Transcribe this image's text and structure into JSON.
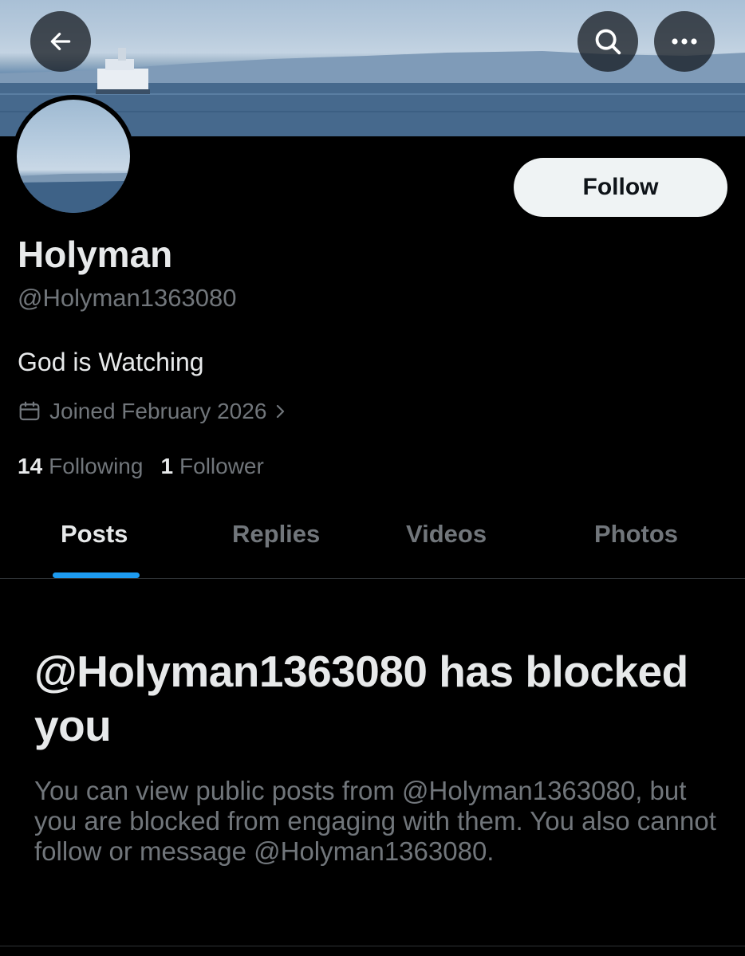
{
  "header": {
    "back_icon": "arrow-left-icon",
    "search_icon": "search-icon",
    "more_icon": "more-horizontal-icon"
  },
  "profile": {
    "follow_label": "Follow",
    "display_name": "Holyman",
    "handle": "@Holyman1363080",
    "bio": "God is Watching",
    "joined": "Joined February 2026",
    "following_count": "14",
    "following_label": "Following",
    "followers_count": "1",
    "followers_label": "Follower"
  },
  "tabs": [
    {
      "label": "Posts",
      "active": true
    },
    {
      "label": "Replies",
      "active": false
    },
    {
      "label": "Videos",
      "active": false
    },
    {
      "label": "Photos",
      "active": false
    }
  ],
  "blocked": {
    "title": "@Holyman1363080 has blocked you",
    "message": "You can view public posts from @Holyman1363080, but you are blocked from engaging with them. You also cannot follow or message @Holyman1363080."
  },
  "colors": {
    "background": "#000000",
    "primary_text": "#e7e9ea",
    "secondary_text": "#71767b",
    "accent": "#1d9bf0",
    "follow_button_bg": "#eff3f4"
  }
}
